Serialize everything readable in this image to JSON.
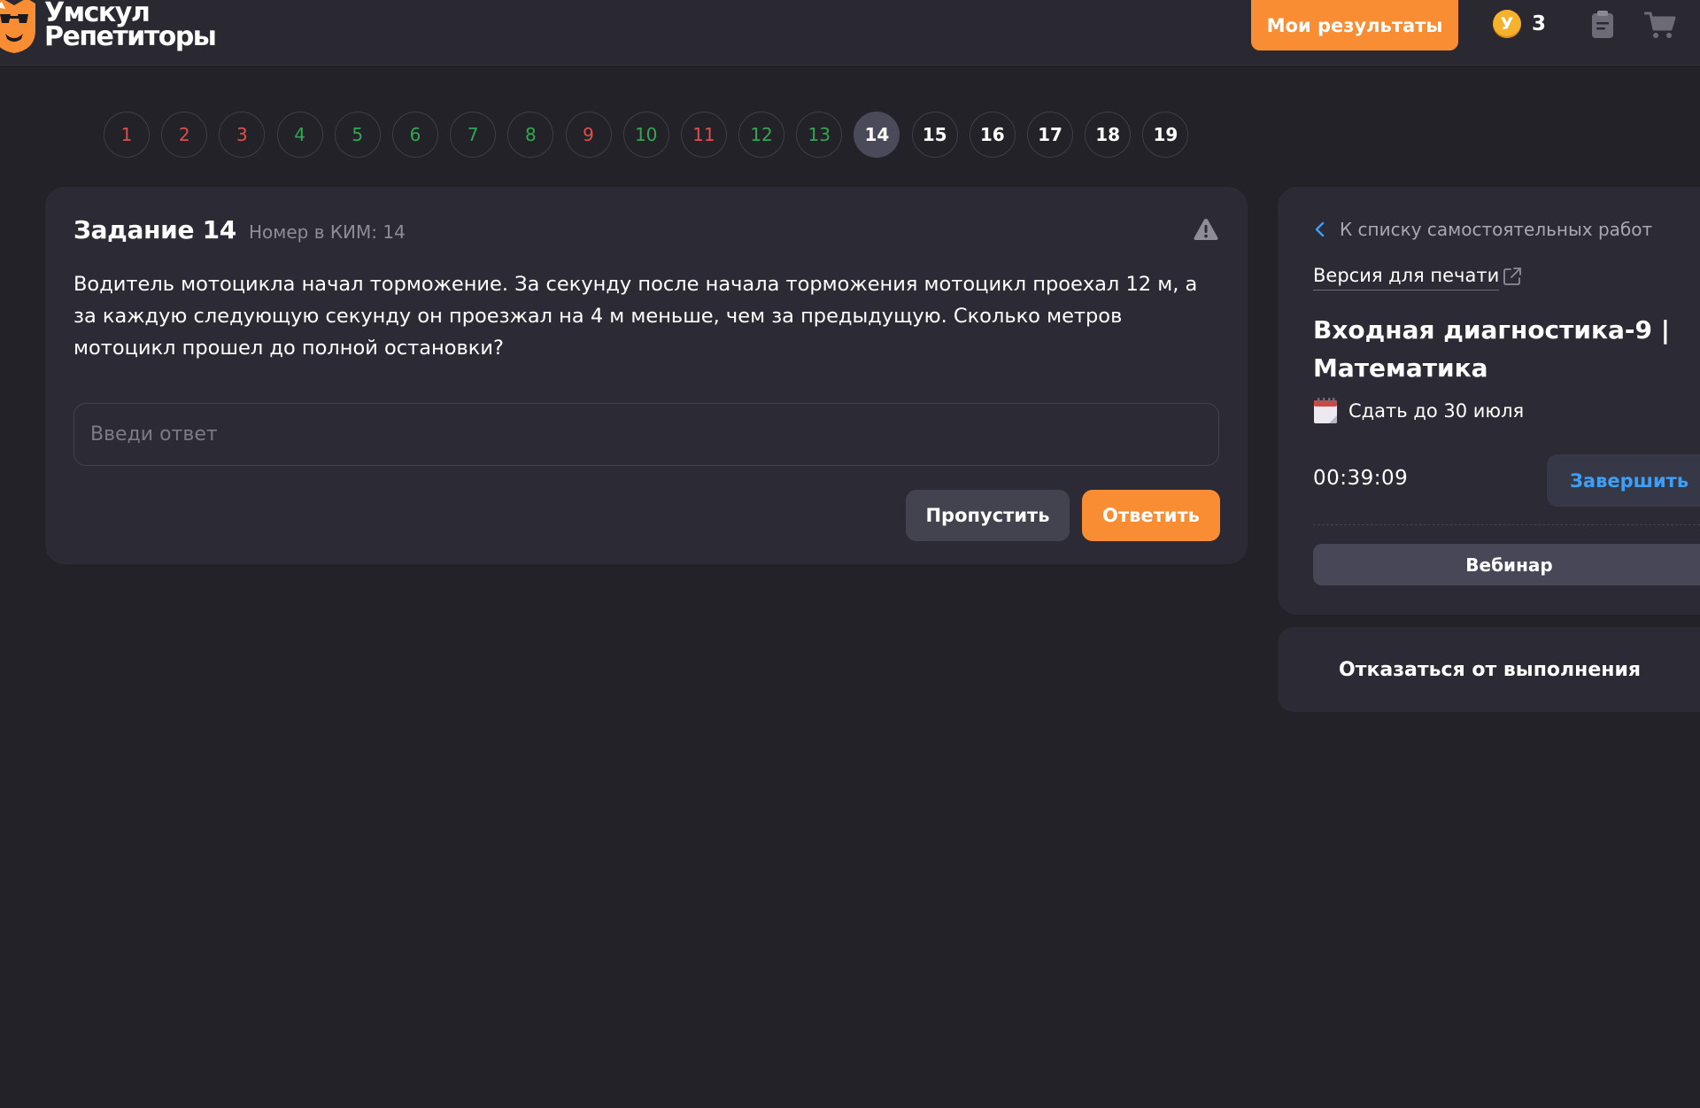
{
  "header": {
    "logo_line1": "Умскул",
    "logo_line2": "Репетиторы",
    "results_label": "Мои результаты",
    "coin_letter": "У",
    "coins": "3",
    "brand_color": "#f98d33"
  },
  "pager": {
    "items": [
      {
        "label": "1",
        "status": "wrong"
      },
      {
        "label": "2",
        "status": "wrong"
      },
      {
        "label": "3",
        "status": "wrong"
      },
      {
        "label": "4",
        "status": "correct"
      },
      {
        "label": "5",
        "status": "correct"
      },
      {
        "label": "6",
        "status": "correct"
      },
      {
        "label": "7",
        "status": "correct"
      },
      {
        "label": "8",
        "status": "correct"
      },
      {
        "label": "9",
        "status": "wrong"
      },
      {
        "label": "10",
        "status": "correct"
      },
      {
        "label": "11",
        "status": "wrong"
      },
      {
        "label": "12",
        "status": "correct"
      },
      {
        "label": "13",
        "status": "correct"
      },
      {
        "label": "14",
        "status": "current"
      },
      {
        "label": "15",
        "status": "unanswered"
      },
      {
        "label": "16",
        "status": "unanswered"
      },
      {
        "label": "17",
        "status": "unanswered"
      },
      {
        "label": "18",
        "status": "unanswered"
      },
      {
        "label": "19",
        "status": "unanswered"
      }
    ],
    "colors": {
      "wrong": "#e24c4b",
      "correct": "#2fa84f",
      "current": "#4a4a5a"
    }
  },
  "task": {
    "title": "Задание 14",
    "kim": "Номер в КИМ: 14",
    "text": "Водитель мотоцикла начал торможение. За секунду после начала торможения мотоцикл проехал 12 м, а за каждую следующую секунду он проезжал на 4 м меньше, чем за предыдущую. Сколько метров мотоцикл прошел до полной остановки?",
    "answer_value": "",
    "answer_placeholder": "Введи ответ",
    "skip_label": "Пропустить",
    "answer_label": "Ответить"
  },
  "side": {
    "back_label": "К списку самостоятельных работ",
    "print_label": "Версия для печати",
    "work_title": "Входная диагностика-9 | Математика",
    "deadline": "Сдать до 30 июля",
    "timer": "00:39:09",
    "finish_label": "Завершить",
    "webinar_label": "Вебинар",
    "decline_label": "Отказаться от выполнения"
  },
  "icons": {
    "logo": "fox-glasses-logo-icon",
    "coin": "coin-icon",
    "notes": "notes-icon",
    "cart": "cart-icon",
    "warning": "warning-triangle-icon",
    "back": "chevron-left-icon",
    "external": "external-link-icon",
    "calendar": "calendar-icon"
  }
}
